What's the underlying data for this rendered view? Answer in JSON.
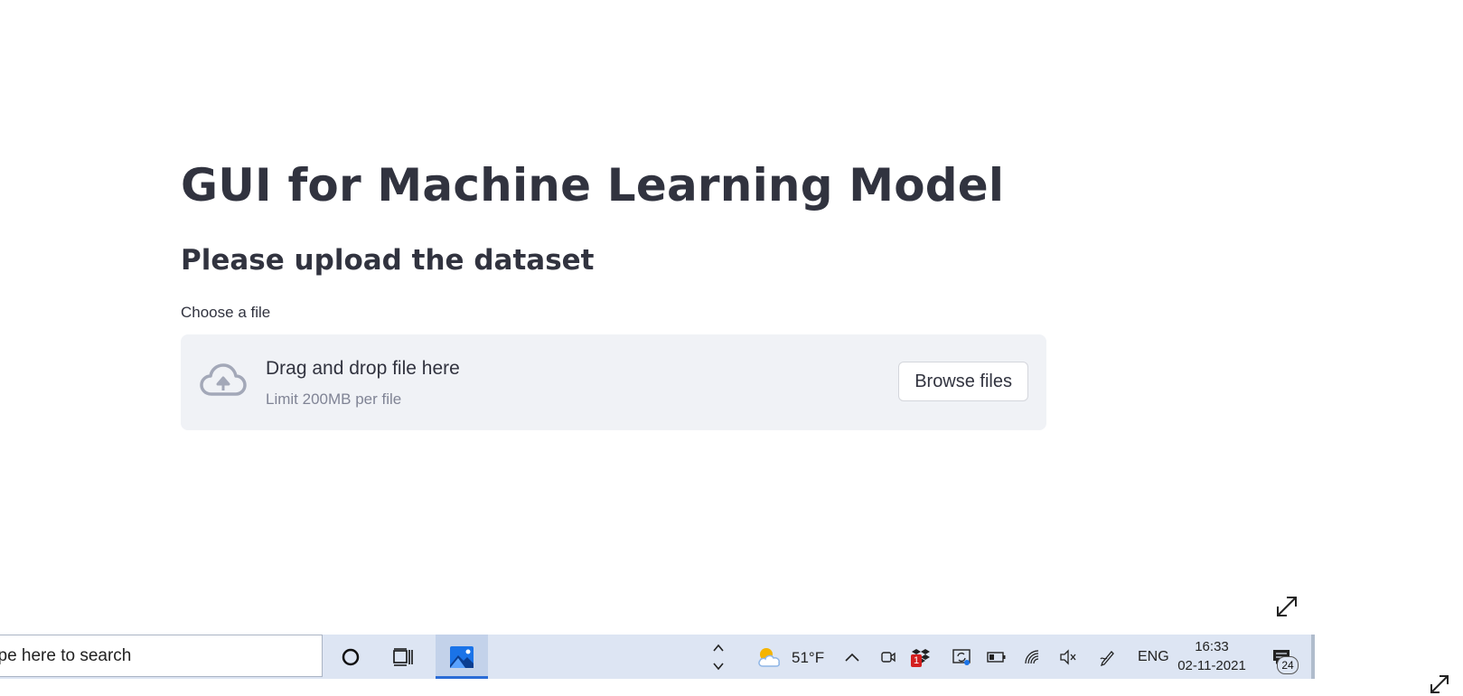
{
  "app": {
    "title": "GUI for Machine Learning Model",
    "subtitle": "Please upload the dataset",
    "uploader": {
      "label": "Choose a file",
      "drop_text": "Drag and drop file here",
      "limit_text": "Limit 200MB per file",
      "browse_label": "Browse files"
    }
  },
  "taskbar": {
    "search_text": "ype here to search",
    "weather_temp": "51°F",
    "language": "ENG",
    "time": "16:33",
    "date": "02-11-2021",
    "notification_count": "24",
    "dropbox_badge": "1"
  },
  "icons": {
    "upload": "cloud-upload-icon",
    "cortana": "cortana-circle-icon",
    "task_view": "task-view-icon",
    "photos": "photos-app-icon",
    "weather": "partly-cloudy-icon",
    "chevron_up": "chevron-up-icon",
    "meet_now": "meet-now-icon",
    "dropbox": "dropbox-icon",
    "onedrive_sync": "sync-icon",
    "battery": "battery-icon",
    "wifi": "wifi-icon",
    "volume": "volume-muted-icon",
    "pen": "pen-icon",
    "notifications": "notification-icon",
    "expand": "expand-icon"
  },
  "colors": {
    "text_primary": "#31333f",
    "text_muted": "#808495",
    "dropzone_bg": "#f0f2f6",
    "taskbar_bg": "#dde5f3",
    "taskbar_accent": "#2b6cd6"
  }
}
